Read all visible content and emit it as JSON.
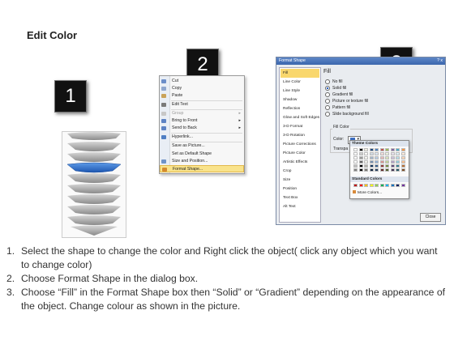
{
  "title": "Edit Color",
  "step_badges": [
    "1",
    "2",
    "3"
  ],
  "context_menu": {
    "items": [
      {
        "label": "Cut",
        "icon": "scissors-icon",
        "disabled": false,
        "submenu": false
      },
      {
        "label": "Copy",
        "icon": "copy-icon",
        "disabled": false,
        "submenu": false
      },
      {
        "label": "Paste",
        "icon": "paste-icon",
        "disabled": false,
        "submenu": false
      },
      {
        "label": "Edit Text",
        "icon": "edit-text-icon",
        "disabled": false,
        "submenu": false
      },
      {
        "label": "Group",
        "icon": "group-icon",
        "disabled": true,
        "submenu": true
      },
      {
        "label": "Bring to Front",
        "icon": "bring-front-icon",
        "disabled": false,
        "submenu": true
      },
      {
        "label": "Send to Back",
        "icon": "send-back-icon",
        "disabled": false,
        "submenu": true
      },
      {
        "label": "Hyperlink...",
        "icon": "hyperlink-icon",
        "disabled": false,
        "submenu": false
      },
      {
        "label": "Save as Picture...",
        "icon": "",
        "disabled": false,
        "submenu": false
      },
      {
        "label": "Set as Default Shape",
        "icon": "",
        "disabled": false,
        "submenu": false
      },
      {
        "label": "Size and Position...",
        "icon": "size-position-icon",
        "disabled": false,
        "submenu": false
      },
      {
        "label": "Format Shape...",
        "icon": "format-shape-icon",
        "disabled": false,
        "submenu": false,
        "selected": true
      }
    ]
  },
  "dialog": {
    "title": "Format Shape",
    "close": "?  x",
    "sidebar": [
      "Fill",
      "Line Color",
      "Line Style",
      "Shadow",
      "Reflection",
      "Glow and Soft Edges",
      "3-D Format",
      "3-D Rotation",
      "Picture Corrections",
      "Picture Color",
      "Artistic Effects",
      "Crop",
      "Size",
      "Position",
      "Text Box",
      "Alt Text"
    ],
    "active_sidebar": "Fill",
    "fill_heading": "Fill",
    "fill_options": [
      "No fill",
      "Solid fill",
      "Gradient fill",
      "Picture or texture fill",
      "Pattern fill",
      "Slide background fill"
    ],
    "selected_fill": "Solid fill",
    "fill_color_label": "Fill Color",
    "color_label": "Color:",
    "transparency_label": "Transpa",
    "popup": {
      "theme_colors_label": "Theme Colors",
      "standard_colors_label": "Standard Colors",
      "more_colors_label": "More Colors...",
      "theme_colors": [
        "#ffffff",
        "#000000",
        "#eeece1",
        "#1f497d",
        "#4f81bd",
        "#c0504d",
        "#9bbb59",
        "#8064a2",
        "#4bacc6",
        "#f79646"
      ],
      "standard_colors": [
        "#c00000",
        "#ff0000",
        "#ffc000",
        "#ffff00",
        "#92d050",
        "#00b050",
        "#00b0f0",
        "#0070c0",
        "#002060",
        "#7030a0"
      ]
    },
    "close_button": "Close"
  },
  "instructions": [
    {
      "num": "1.",
      "text": "Select the shape to change the color and Right click the object( click any object which you want to change color)"
    },
    {
      "num": "2.",
      "text": "Choose Format Shape in the dialog box."
    },
    {
      "num": "3.",
      "text": "Choose “Fill” in the Format Shape box then “Solid” or “Gradient” depending on the appearance of the object. Change colour as shown in the picture."
    }
  ],
  "colors": {
    "selected_chevron": "#2f6fc5",
    "chevron_gray": "#9a9a9a",
    "menu_highlight": "#f9e38b",
    "dialog_title": "#3b66ad"
  }
}
